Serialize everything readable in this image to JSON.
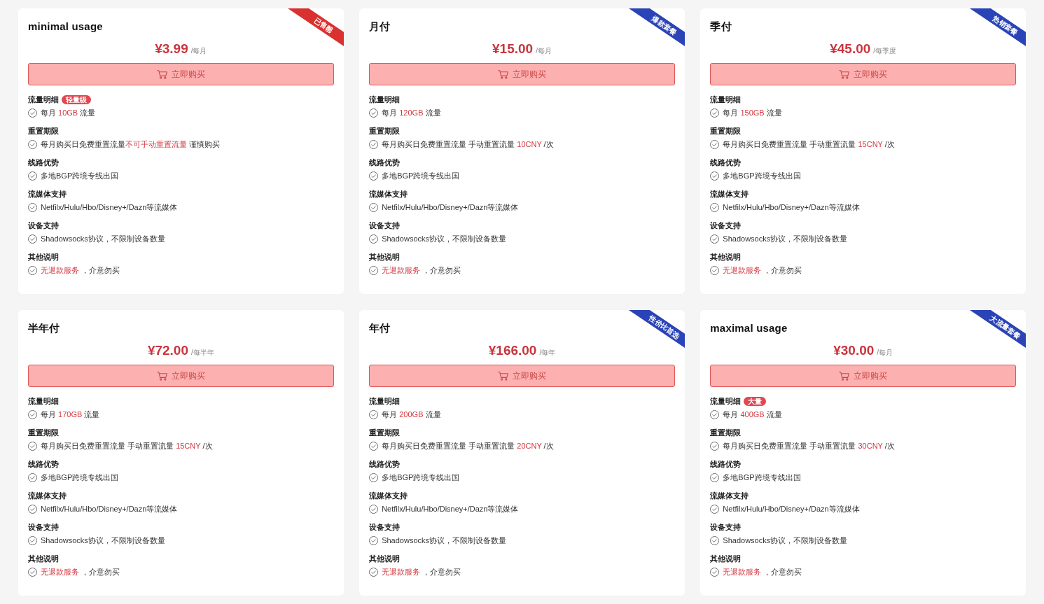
{
  "plans": [
    {
      "title": "minimal usage",
      "ribbon": {
        "label": "已售罄",
        "color": "#d9312f"
      },
      "price": "¥3.99",
      "period": "/每月",
      "buy_button": "立即购买",
      "features": [
        {
          "heading": "流量明细",
          "badge": "轻量级",
          "item": "每月 **10GB** 流量"
        },
        {
          "heading": "重置期限",
          "item": "每月购买日免费重置流量**不可手动重置流量** 谨慎购买"
        },
        {
          "heading": "线路优势",
          "item": "多地BGP跨境专线出国"
        },
        {
          "heading": "流媒体支持",
          "item": "Netfilx/Hulu/Hbo/Disney+/Dazn等流媒体"
        },
        {
          "heading": "设备支持",
          "item": "Shadowsocks协议，不限制设备数量"
        },
        {
          "heading": "其他说明",
          "item": "**无退款服务** ，介意勿买"
        }
      ]
    },
    {
      "title": "月付",
      "ribbon": {
        "label": "爆款套餐",
        "color": "#2a43b6"
      },
      "price": "¥15.00",
      "period": "/每月",
      "buy_button": "立即购买",
      "features": [
        {
          "heading": "流量明细",
          "item": "每月 **120GB** 流量"
        },
        {
          "heading": "重置期限",
          "item": "每月购买日免费重置流量 手动重置流量 **10CNY** /次"
        },
        {
          "heading": "线路优势",
          "item": "多地BGP跨境专线出国"
        },
        {
          "heading": "流媒体支持",
          "item": "Netfilx/Hulu/Hbo/Disney+/Dazn等流媒体"
        },
        {
          "heading": "设备支持",
          "item": "Shadowsocks协议，不限制设备数量"
        },
        {
          "heading": "其他说明",
          "item": "**无退款服务** ，介意勿买"
        }
      ]
    },
    {
      "title": "季付",
      "ribbon": {
        "label": "热销套餐",
        "color": "#2a43b6"
      },
      "price": "¥45.00",
      "period": "/每季度",
      "buy_button": "立即购买",
      "features": [
        {
          "heading": "流量明细",
          "item": "每月 **150GB** 流量"
        },
        {
          "heading": "重置期限",
          "item": "每月购买日免费重置流量 手动重置流量 **15CNY** /次"
        },
        {
          "heading": "线路优势",
          "item": "多地BGP跨境专线出国"
        },
        {
          "heading": "流媒体支持",
          "item": "Netfilx/Hulu/Hbo/Disney+/Dazn等流媒体"
        },
        {
          "heading": "设备支持",
          "item": "Shadowsocks协议，不限制设备数量"
        },
        {
          "heading": "其他说明",
          "item": "**无退款服务** ，介意勿买"
        }
      ]
    },
    {
      "title": "半年付",
      "price": "¥72.00",
      "period": "/每半年",
      "buy_button": "立即购买",
      "features": [
        {
          "heading": "流量明细",
          "item": "每月 **170GB** 流量"
        },
        {
          "heading": "重置期限",
          "item": "每月购买日免费重置流量 手动重置流量 **15CNY** /次"
        },
        {
          "heading": "线路优势",
          "item": "多地BGP跨境专线出国"
        },
        {
          "heading": "流媒体支持",
          "item": "Netfilx/Hulu/Hbo/Disney+/Dazn等流媒体"
        },
        {
          "heading": "设备支持",
          "item": "Shadowsocks协议，不限制设备数量"
        },
        {
          "heading": "其他说明",
          "item": "**无退款服务** ，介意勿买"
        }
      ]
    },
    {
      "title": "年付",
      "ribbon": {
        "label": "性价比首选",
        "color": "#2a43b6"
      },
      "price": "¥166.00",
      "period": "/每年",
      "buy_button": "立即购买",
      "features": [
        {
          "heading": "流量明细",
          "item": "每月 **200GB** 流量"
        },
        {
          "heading": "重置期限",
          "item": "每月购买日免费重置流量 手动重置流量 **20CNY** /次"
        },
        {
          "heading": "线路优势",
          "item": "多地BGP跨境专线出国"
        },
        {
          "heading": "流媒体支持",
          "item": "Netfilx/Hulu/Hbo/Disney+/Dazn等流媒体"
        },
        {
          "heading": "设备支持",
          "item": "Shadowsocks协议，不限制设备数量"
        },
        {
          "heading": "其他说明",
          "item": "**无退款服务** ，介意勿买"
        }
      ]
    },
    {
      "title": "maximal usage",
      "ribbon": {
        "label": "大流量套餐",
        "color": "#2a43b6"
      },
      "price": "¥30.00",
      "period": "/每月",
      "buy_button": "立即购买",
      "features": [
        {
          "heading": "流量明细",
          "badge": "大量",
          "item": "每月 **400GB** 流量"
        },
        {
          "heading": "重置期限",
          "item": "每月购买日免费重置流量 手动重置流量 **30CNY** /次"
        },
        {
          "heading": "线路优势",
          "item": "多地BGP跨境专线出国"
        },
        {
          "heading": "流媒体支持",
          "item": "Netfilx/Hulu/Hbo/Disney+/Dazn等流媒体"
        },
        {
          "heading": "设备支持",
          "item": "Shadowsocks协议，不限制设备数量"
        },
        {
          "heading": "其他说明",
          "item": "**无退款服务** ，介意勿买"
        }
      ]
    }
  ]
}
